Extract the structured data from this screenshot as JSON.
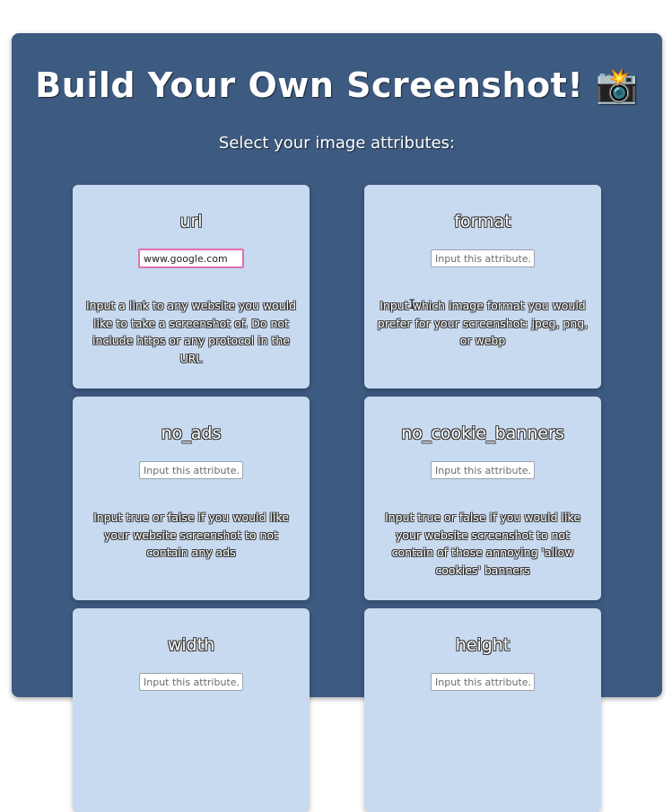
{
  "header": {
    "title": "Build Your Own Screenshot! 📸",
    "subtitle": "Select your image attributes:"
  },
  "cards": [
    {
      "name": "url",
      "value": "www.google.com",
      "placeholder": "Input this attribute...",
      "description": "Input a link to any website you would like to take a screenshot of. Do not include https or any protocol in the URL"
    },
    {
      "name": "format",
      "value": "",
      "placeholder": "Input this attribute...",
      "description": "Input which image format you would prefer for your screenshot: jpeg, png, or webp"
    },
    {
      "name": "no_ads",
      "value": "",
      "placeholder": "Input this attribute...",
      "description": "Input true or false if you would like your website screenshot to not contain any ads"
    },
    {
      "name": "no_cookie_banners",
      "value": "",
      "placeholder": "Input this attribute...",
      "description": "Input true or false if you would like your website screenshot to not contain of those annoying 'allow cookies' banners"
    },
    {
      "name": "width",
      "value": "",
      "placeholder": "Input this attribute...",
      "description": ""
    },
    {
      "name": "height",
      "value": "",
      "placeholder": "Input this attribute...",
      "description": ""
    }
  ]
}
